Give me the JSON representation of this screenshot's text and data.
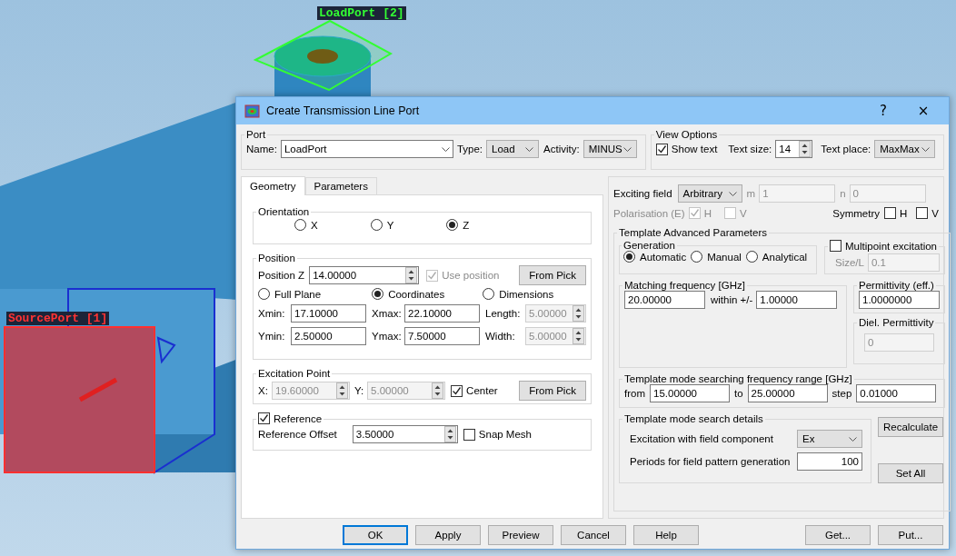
{
  "viewport": {
    "port_labels": [
      {
        "text": "LoadPort [2]",
        "kind": "load"
      },
      {
        "text": "SourcePort [1]",
        "kind": "source"
      }
    ]
  },
  "dialog": {
    "title": "Create Transmission Line Port",
    "help": "?",
    "close": "×",
    "port": {
      "legend": "Port",
      "name_label": "Name:",
      "name": {
        "value": "LoadPort"
      },
      "type_label": "Type:",
      "type": {
        "value": "Load"
      },
      "activity_label": "Activity:",
      "activity": {
        "value": "MINUS"
      }
    },
    "view_options": {
      "legend": "View Options",
      "show_text": {
        "label": "Show text",
        "checked": true,
        "disabled": false
      },
      "text_size_label": "Text size:",
      "text_size": {
        "value": "14",
        "disabled": false
      },
      "text_place_label": "Text place:",
      "text_place": {
        "value": "MaxMax"
      }
    },
    "tabs": [
      {
        "label": "Geometry",
        "selected": true
      },
      {
        "label": "Parameters",
        "selected": false
      }
    ],
    "orientation": {
      "legend": "Orientation",
      "options": [
        {
          "label": "X",
          "selected": false
        },
        {
          "label": "Y",
          "selected": false
        },
        {
          "label": "Z",
          "selected": true
        }
      ]
    },
    "position": {
      "legend": "Position",
      "z_label": "Position Z",
      "z": {
        "value": "14.00000",
        "disabled": false
      },
      "use_position": {
        "label": "Use position",
        "checked": true,
        "disabled": true
      },
      "from_pick": "From Pick",
      "modes": [
        {
          "label": "Full Plane",
          "selected": false
        },
        {
          "label": "Coordinates",
          "selected": true
        },
        {
          "label": "Dimensions",
          "selected": false
        }
      ],
      "fields": [
        {
          "label": "Xmin:",
          "value": "17.10000",
          "kind": "text",
          "disabled": false
        },
        {
          "label": "Xmax:",
          "value": "22.10000",
          "kind": "text",
          "disabled": false
        },
        {
          "label": "Length:",
          "value": "5.00000",
          "kind": "spin",
          "disabled": true
        },
        {
          "label": "Ymin:",
          "value": "2.50000",
          "kind": "text",
          "disabled": false
        },
        {
          "label": "Ymax:",
          "value": "7.50000",
          "kind": "text",
          "disabled": false
        },
        {
          "label": "Width:",
          "value": "5.00000",
          "kind": "spin",
          "disabled": true
        }
      ]
    },
    "excitation_point": {
      "legend": "Excitation Point",
      "fields": [
        {
          "label": "X:",
          "value": "19.60000",
          "disabled": true
        },
        {
          "label": "Y:",
          "value": "5.00000",
          "disabled": true
        }
      ],
      "center": {
        "label": "Center",
        "checked": true,
        "disabled": false
      },
      "from_pick": "From Pick"
    },
    "reference": {
      "label": "Reference",
      "checked": true,
      "disabled": false,
      "offset_label": "Reference Offset",
      "offset": {
        "value": "3.50000",
        "disabled": false
      },
      "snap_mesh": {
        "label": "Snap Mesh",
        "checked": false,
        "disabled": false
      }
    },
    "exciting_field": {
      "label": "Exciting field",
      "mode": {
        "value": "Arbitrary"
      },
      "m_label": "m",
      "m": {
        "value": "1",
        "disabled": true
      },
      "n_label": "n",
      "n": {
        "value": "0",
        "disabled": true
      },
      "polarisation_label": "Polarisation (E)",
      "polarisation": [
        {
          "label": "H",
          "checked": true,
          "disabled": true
        },
        {
          "label": "V",
          "checked": false,
          "disabled": true
        }
      ],
      "symmetry_label": "Symmetry",
      "symmetry": [
        {
          "label": "H",
          "checked": false,
          "disabled": false
        },
        {
          "label": "V",
          "checked": false,
          "disabled": false
        }
      ]
    },
    "template": {
      "legend": "Template Advanced Parameters",
      "generation": {
        "legend": "Generation",
        "options": [
          {
            "label": "Automatic",
            "selected": true
          },
          {
            "label": "Manual",
            "selected": false
          },
          {
            "label": "Analytical",
            "selected": false
          }
        ]
      },
      "multipoint": {
        "label": "Multipoint excitation",
        "checked": false,
        "disabled": false
      },
      "size_label": "Size/L",
      "size": {
        "value": "0.1",
        "disabled": true
      },
      "matching": {
        "legend": "Matching frequency [GHz]",
        "value": {
          "value": "20.00000",
          "disabled": false
        },
        "within_label": "within +/-",
        "within": {
          "value": "1.00000",
          "disabled": false
        }
      },
      "permittivity_eff": {
        "legend": "Permittivity (eff.)",
        "value": {
          "value": "1.0000000",
          "disabled": false
        }
      },
      "diel_permittivity": {
        "legend": "Diel. Permittivity",
        "value": {
          "value": "0",
          "disabled": true
        }
      },
      "range": {
        "legend": "Template mode searching frequency range [GHz]",
        "from_label": "from",
        "from": {
          "value": "15.00000",
          "disabled": false
        },
        "to_label": "to",
        "to": {
          "value": "25.00000",
          "disabled": false
        },
        "step_label": "step",
        "step": {
          "value": "0.01000",
          "disabled": false
        }
      },
      "details": {
        "legend": "Template mode search details",
        "component_label": "Excitation with field component",
        "component": {
          "value": "Ex"
        },
        "periods_label": "Periods for field pattern generation",
        "periods": {
          "value": "100",
          "disabled": false
        }
      },
      "recalculate": "Recalculate",
      "set_all": "Set All"
    },
    "buttons": [
      {
        "label": "OK",
        "default": true
      },
      {
        "label": "Apply",
        "default": false
      },
      {
        "label": "Preview",
        "default": false
      },
      {
        "label": "Cancel",
        "default": false
      },
      {
        "label": "Help",
        "default": false
      }
    ],
    "extra_buttons": [
      {
        "label": "Get...",
        "default": false
      },
      {
        "label": "Put...",
        "default": false
      }
    ]
  }
}
